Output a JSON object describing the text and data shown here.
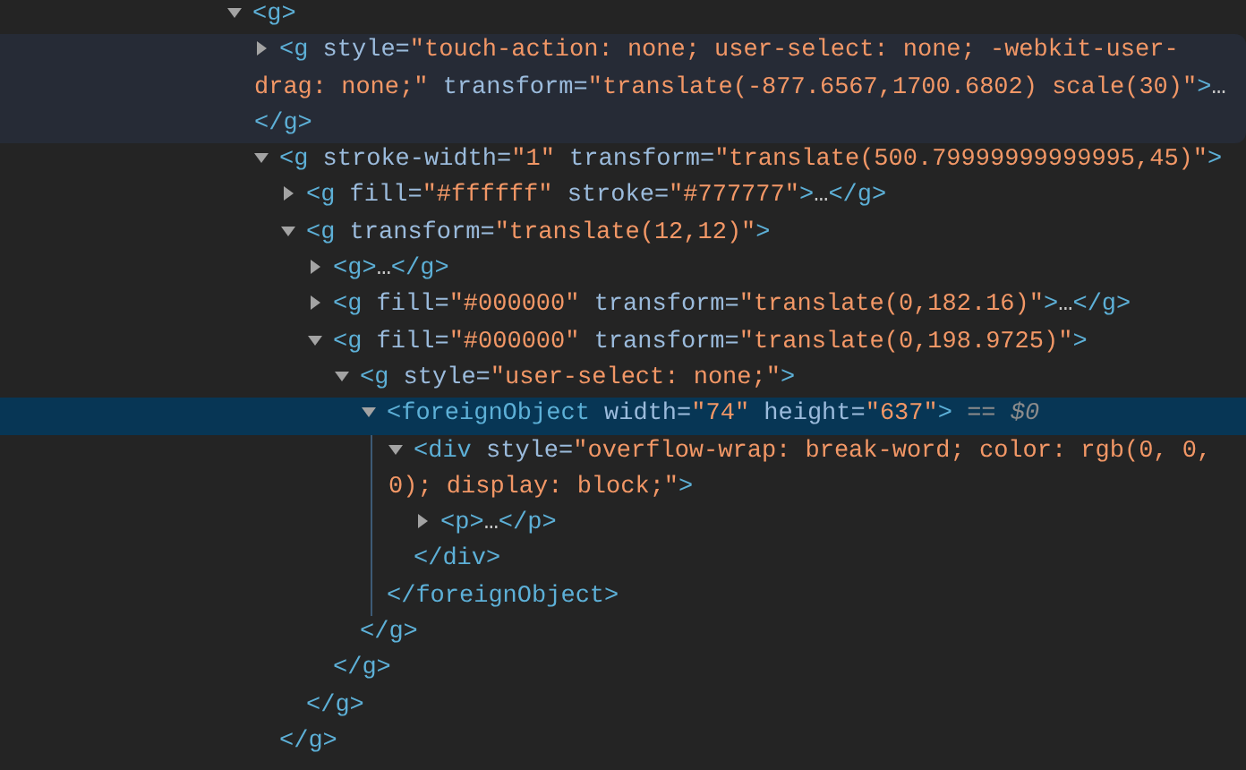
{
  "elements_tree": {
    "nodes": [
      {
        "open": [
          {
            "kind": "tag",
            "text": "<g>"
          }
        ],
        "expanded": true,
        "hovered": false,
        "selected": false,
        "children": [
          {
            "open": [
              {
                "kind": "tag",
                "text": "<g"
              },
              {
                "kind": "attr",
                "text": " style="
              },
              {
                "kind": "value",
                "text": "\"touch-action: none; user-select: none; -webkit-user-drag: none;\""
              },
              {
                "kind": "attr",
                "text": " transform="
              },
              {
                "kind": "value",
                "text": "\"translate(-877.6567,1700.6802) scale(30)\""
              },
              {
                "kind": "tag",
                "text": ">"
              },
              {
                "kind": "ellipsis",
                "text": "…"
              }
            ],
            "close": [
              {
                "kind": "tag",
                "text": "</g>"
              }
            ],
            "expanded": false,
            "hovered": true,
            "selected": false
          },
          {
            "open": [
              {
                "kind": "tag",
                "text": "<g"
              },
              {
                "kind": "attr",
                "text": " stroke-width="
              },
              {
                "kind": "value",
                "text": "\"1\""
              },
              {
                "kind": "attr",
                "text": " transform="
              },
              {
                "kind": "value",
                "text": "\"translate(500.79999999999995,45)\""
              },
              {
                "kind": "tag",
                "text": ">"
              }
            ],
            "expanded": true,
            "hovered": false,
            "selected": false,
            "children": [
              {
                "open": [
                  {
                    "kind": "tag",
                    "text": "<g"
                  },
                  {
                    "kind": "attr",
                    "text": " fill="
                  },
                  {
                    "kind": "value",
                    "text": "\"#ffffff\""
                  },
                  {
                    "kind": "attr",
                    "text": " stroke="
                  },
                  {
                    "kind": "value",
                    "text": "\"#777777\""
                  },
                  {
                    "kind": "tag",
                    "text": ">"
                  },
                  {
                    "kind": "ellipsis",
                    "text": "…"
                  }
                ],
                "close": [
                  {
                    "kind": "tag",
                    "text": "</g>"
                  }
                ],
                "expanded": false,
                "hovered": false,
                "selected": false
              },
              {
                "open": [
                  {
                    "kind": "tag",
                    "text": "<g"
                  },
                  {
                    "kind": "attr",
                    "text": " transform="
                  },
                  {
                    "kind": "value",
                    "text": "\"translate(12,12)\""
                  },
                  {
                    "kind": "tag",
                    "text": ">"
                  }
                ],
                "expanded": true,
                "hovered": false,
                "selected": false,
                "children": [
                  {
                    "open": [
                      {
                        "kind": "tag",
                        "text": "<g>"
                      },
                      {
                        "kind": "ellipsis",
                        "text": "…"
                      }
                    ],
                    "close": [
                      {
                        "kind": "tag",
                        "text": "</g>"
                      }
                    ],
                    "expanded": false,
                    "hovered": false,
                    "selected": false
                  },
                  {
                    "open": [
                      {
                        "kind": "tag",
                        "text": "<g"
                      },
                      {
                        "kind": "attr",
                        "text": " fill="
                      },
                      {
                        "kind": "value",
                        "text": "\"#000000\""
                      },
                      {
                        "kind": "attr",
                        "text": " transform="
                      },
                      {
                        "kind": "value",
                        "text": "\"translate(0,182.16)\""
                      },
                      {
                        "kind": "tag",
                        "text": ">"
                      },
                      {
                        "kind": "ellipsis",
                        "text": "…"
                      }
                    ],
                    "close": [
                      {
                        "kind": "tag",
                        "text": "</g>"
                      }
                    ],
                    "expanded": false,
                    "hovered": false,
                    "selected": false
                  },
                  {
                    "open": [
                      {
                        "kind": "tag",
                        "text": "<g"
                      },
                      {
                        "kind": "attr",
                        "text": " fill="
                      },
                      {
                        "kind": "value",
                        "text": "\"#000000\""
                      },
                      {
                        "kind": "attr",
                        "text": " transform="
                      },
                      {
                        "kind": "value",
                        "text": "\"translate(0,198.9725)\""
                      },
                      {
                        "kind": "tag",
                        "text": ">"
                      }
                    ],
                    "expanded": true,
                    "hovered": false,
                    "selected": false,
                    "children": [
                      {
                        "open": [
                          {
                            "kind": "tag",
                            "text": "<g"
                          },
                          {
                            "kind": "attr",
                            "text": " style="
                          },
                          {
                            "kind": "value",
                            "text": "\"user-select: none;\""
                          },
                          {
                            "kind": "tag",
                            "text": ">"
                          }
                        ],
                        "expanded": true,
                        "hovered": false,
                        "selected": false,
                        "children": [
                          {
                            "open": [
                              {
                                "kind": "tag",
                                "text": "<foreignObject"
                              },
                              {
                                "kind": "attr",
                                "text": " width="
                              },
                              {
                                "kind": "value",
                                "text": "\"74\""
                              },
                              {
                                "kind": "attr",
                                "text": " height="
                              },
                              {
                                "kind": "value",
                                "text": "\"637\""
                              },
                              {
                                "kind": "tag",
                                "text": ">"
                              },
                              {
                                "kind": "console_ref",
                                "text": " == $0"
                              }
                            ],
                            "expanded": true,
                            "hovered": false,
                            "selected": true,
                            "children": [
                              {
                                "open": [
                                  {
                                    "kind": "tag",
                                    "text": "<div"
                                  },
                                  {
                                    "kind": "attr",
                                    "text": " style="
                                  },
                                  {
                                    "kind": "value",
                                    "text": "\"overflow-wrap: break-word; color: rgb(0, 0, 0); display: block;\""
                                  },
                                  {
                                    "kind": "tag",
                                    "text": ">"
                                  }
                                ],
                                "expanded": true,
                                "hovered": false,
                                "selected": false,
                                "children": [
                                  {
                                    "open": [
                                      {
                                        "kind": "tag",
                                        "text": "<p>"
                                      },
                                      {
                                        "kind": "ellipsis",
                                        "text": "…"
                                      }
                                    ],
                                    "close": [
                                      {
                                        "kind": "tag",
                                        "text": "</p>"
                                      }
                                    ],
                                    "expanded": false,
                                    "hovered": false,
                                    "selected": false
                                  }
                                ],
                                "close": [
                                  {
                                    "kind": "tag",
                                    "text": "</div>"
                                  }
                                ]
                              }
                            ],
                            "close": [
                              {
                                "kind": "tag",
                                "text": "</foreignObject>"
                              }
                            ]
                          }
                        ],
                        "close": [
                          {
                            "kind": "tag",
                            "text": "</g>"
                          }
                        ]
                      }
                    ],
                    "close": [
                      {
                        "kind": "tag",
                        "text": "</g>"
                      }
                    ]
                  }
                ],
                "close": [
                  {
                    "kind": "tag",
                    "text": "</g>"
                  }
                ]
              }
            ],
            "close": [
              {
                "kind": "tag",
                "text": "</g>"
              }
            ]
          }
        ]
      }
    ]
  }
}
